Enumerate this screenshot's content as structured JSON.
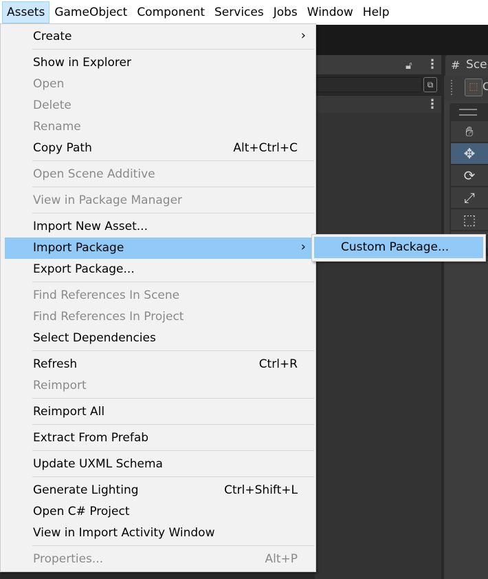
{
  "menubar": {
    "items": [
      "Assets",
      "GameObject",
      "Component",
      "Services",
      "Jobs",
      "Window",
      "Help"
    ],
    "active": "Assets"
  },
  "scene": {
    "tab_label": "Sce",
    "toolbar_label": "C"
  },
  "icons": {
    "lock": "lock-icon",
    "kebab": "kebab-menu-icon",
    "hash": "hash-icon",
    "hand": "hand-tool-icon",
    "move": "move-tool-icon",
    "rotate": "rotate-tool-icon",
    "scale": "scale-tool-icon",
    "rect": "rect-tool-icon",
    "submenu_arrow": "chevron-right-icon"
  },
  "menu": {
    "create": "Create",
    "show_in_explorer": "Show in Explorer",
    "open": "Open",
    "delete": "Delete",
    "rename": "Rename",
    "copy_path": "Copy Path",
    "copy_path_shortcut": "Alt+Ctrl+C",
    "open_scene_additive": "Open Scene Additive",
    "view_in_package_manager": "View in Package Manager",
    "import_new_asset": "Import New Asset...",
    "import_package": "Import Package",
    "export_package": "Export Package...",
    "find_refs_scene": "Find References In Scene",
    "find_refs_project": "Find References In Project",
    "select_dependencies": "Select Dependencies",
    "refresh": "Refresh",
    "refresh_shortcut": "Ctrl+R",
    "reimport": "Reimport",
    "reimport_all": "Reimport All",
    "extract_from_prefab": "Extract From Prefab",
    "update_uxml_schema": "Update UXML Schema",
    "generate_lighting": "Generate Lighting",
    "generate_lighting_shortcut": "Ctrl+Shift+L",
    "open_csharp_project": "Open C# Project",
    "view_import_activity": "View in Import Activity Window",
    "properties": "Properties...",
    "properties_shortcut": "Alt+P",
    "arrow": "›"
  },
  "submenu": {
    "custom_package": "Custom Package..."
  }
}
